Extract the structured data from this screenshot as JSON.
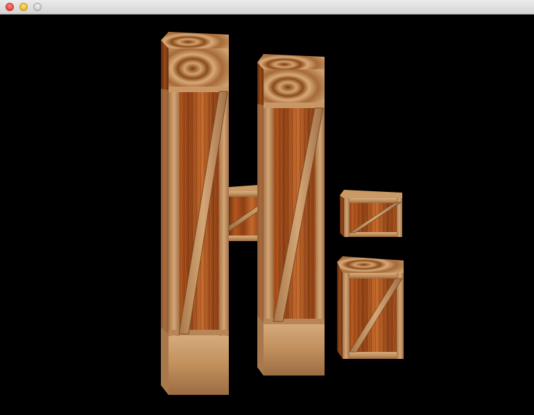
{
  "window": {
    "title": "",
    "buttons": [
      "close",
      "minimize",
      "zoom"
    ]
  },
  "scene": {
    "background": "#000000",
    "colors": {
      "wood_dark": "#7a3a12",
      "wood_mid": "#b45a22",
      "wood_light": "#d49a5e",
      "plank": "#c99a66",
      "plank_edge": "#8a5a30"
    },
    "objects": [
      "crate-pillar-left",
      "crate-pillar-right",
      "crate-crossbar",
      "crate-dot-small",
      "crate-stem-small"
    ]
  }
}
